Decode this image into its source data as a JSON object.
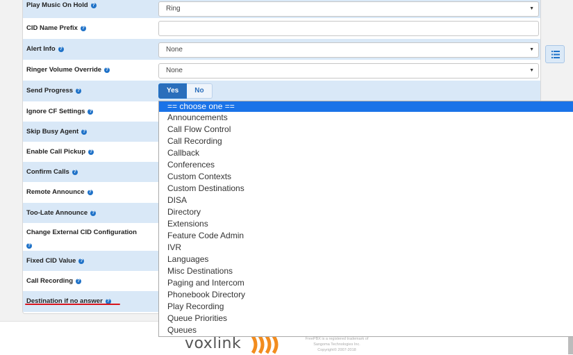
{
  "form": {
    "rows": [
      {
        "label": "Play Music On Hold",
        "type": "select",
        "value": "Ring"
      },
      {
        "label": "CID Name Prefix",
        "type": "text",
        "value": ""
      },
      {
        "label": "Alert Info",
        "type": "select",
        "value": "None"
      },
      {
        "label": "Ringer Volume Override",
        "type": "select",
        "value": "None"
      },
      {
        "label": "Send Progress",
        "type": "toggle",
        "yes": "Yes",
        "no": "No",
        "selected": "Yes"
      },
      {
        "label": "Ignore CF Settings"
      },
      {
        "label": "Skip Busy Agent"
      },
      {
        "label": "Enable Call Pickup"
      },
      {
        "label": "Confirm Calls"
      },
      {
        "label": "Remote Announce"
      },
      {
        "label": "Too-Late Announce"
      },
      {
        "label": "Change External CID Configuration"
      },
      {
        "label": "Fixed CID Value"
      },
      {
        "label": "Call Recording"
      },
      {
        "label": "Destination if no answer"
      }
    ]
  },
  "dropdown": {
    "selected": "== choose one ==",
    "options": [
      "== choose one ==",
      "Announcements",
      "Call Flow Control",
      "Call Recording",
      "Callback",
      "Conferences",
      "Custom Contexts",
      "Custom Destinations",
      "DISA",
      "Directory",
      "Extensions",
      "Feature Code Admin",
      "IVR",
      "Languages",
      "Misc Destinations",
      "Paging and Intercom",
      "Phonebook Directory",
      "Play Recording",
      "Queue Priorities",
      "Queues"
    ]
  },
  "footer": {
    "logo_text": "voxlink",
    "legal_line1": "FreePBX is a registered trademark of",
    "legal_line2": "Sangoma Technologies Inc.",
    "legal_line3": "Copyright© 2007-2018"
  },
  "colors": {
    "accent": "#1f72c8",
    "row_shade": "#d9e8f7",
    "highlight_underline": "#d8141c",
    "logo_orange": "#f28c1e",
    "dropdown_selected": "#1a73e8"
  },
  "icons": {
    "help": "question-circle-icon",
    "side_menu": "list-icon"
  }
}
